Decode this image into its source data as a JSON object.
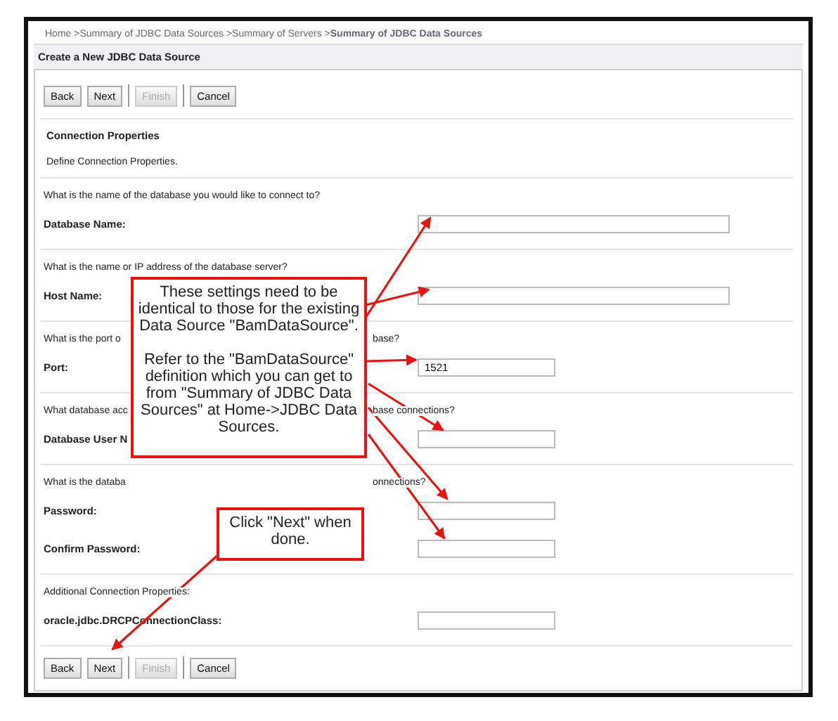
{
  "breadcrumb": "Home >Summary of JDBC Data Sources >Summary of Servers >**Summary of JDBC Data Sources**",
  "title": "Create a New JDBC Data Source",
  "buttons_top": [
    {
      "label": "Back",
      "disabled": false
    },
    {
      "label": "Next",
      "disabled": false
    },
    {
      "label": "Finish",
      "disabled": true
    },
    {
      "label": "Cancel",
      "disabled": false
    }
  ],
  "section": {
    "heading": "Connection Properties",
    "description": "Define Connection Properties."
  },
  "groups": [
    {
      "question": [
        "What is the name of the database you would like to connect to?"
      ],
      "fields": [
        {
          "label": "Database Name:",
          "wide": true
        }
      ]
    },
    {
      "question": [
        "What is the name or IP address of the database server?"
      ],
      "fields": [
        {
          "label": "Host Name:",
          "wide": true
        }
      ]
    },
    {
      "question": [
        "What is the port o",
        "base?"
      ],
      "fields": [
        {
          "label": "Port:",
          "value": "1521",
          "wide": false
        }
      ]
    },
    {
      "question": [
        "What database acc",
        "base connections?"
      ],
      "fields": [
        {
          "label": "Database User N",
          "wide": false
        }
      ]
    },
    {
      "question": [
        "What is the databa",
        "onnections?"
      ],
      "fields": [
        {
          "label": "Password:",
          "wide": false
        },
        {
          "label": "Confirm Password:",
          "wide": false
        }
      ]
    },
    {
      "question": [
        "Additional Connection Properties:"
      ],
      "fields": [
        {
          "label": "oracle.jdbc.DRCPConnectionClass:",
          "wide": false
        }
      ]
    }
  ],
  "buttons_bottom": [
    {
      "label": "Back",
      "disabled": false
    },
    {
      "label": "Next",
      "disabled": false
    },
    {
      "label": "Finish",
      "disabled": true
    },
    {
      "label": "Cancel",
      "disabled": false
    }
  ],
  "callouts": [
    {
      "paragraphs": [
        "These settings need to be identical to those for the existing Data Source \"BamDataSource\".",
        "Refer to the \"BamDataSource\" definition which you can get to from \"Summary of JDBC Data Sources\" at Home->JDBC Data Sources."
      ]
    },
    {
      "paragraphs": [
        "Click \"Next\" when done."
      ]
    }
  ]
}
